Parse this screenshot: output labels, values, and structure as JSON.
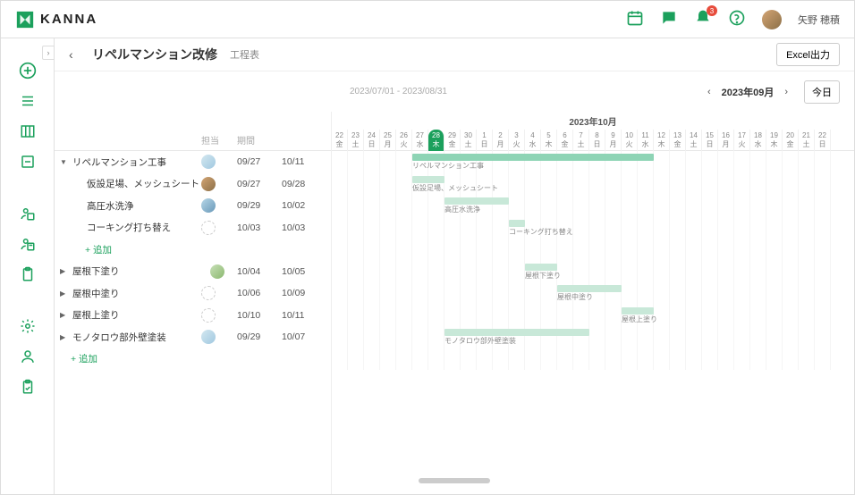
{
  "header": {
    "brand": "KANNA",
    "notification_count": "3",
    "username": "矢野 穂積"
  },
  "page": {
    "title": "リペルマンション改修",
    "subtitle": "工程表",
    "excel_button": "Excel出力",
    "date_range": "2023/07/01 - 2023/08/31",
    "current_month": "2023年09月",
    "today_button": "今日"
  },
  "columns": {
    "assignee": "担当",
    "period": "期間"
  },
  "timeline": {
    "month_label": "2023年10月",
    "today_index": 6,
    "days": [
      {
        "d": "22",
        "w": "金"
      },
      {
        "d": "23",
        "w": "土"
      },
      {
        "d": "24",
        "w": "日"
      },
      {
        "d": "25",
        "w": "月"
      },
      {
        "d": "26",
        "w": "火"
      },
      {
        "d": "27",
        "w": "水"
      },
      {
        "d": "28",
        "w": "木"
      },
      {
        "d": "29",
        "w": "金"
      },
      {
        "d": "30",
        "w": "土"
      },
      {
        "d": "1",
        "w": "日"
      },
      {
        "d": "2",
        "w": "月"
      },
      {
        "d": "3",
        "w": "火"
      },
      {
        "d": "4",
        "w": "水"
      },
      {
        "d": "5",
        "w": "木"
      },
      {
        "d": "6",
        "w": "金"
      },
      {
        "d": "7",
        "w": "土"
      },
      {
        "d": "8",
        "w": "日"
      },
      {
        "d": "9",
        "w": "月"
      },
      {
        "d": "10",
        "w": "火"
      },
      {
        "d": "11",
        "w": "水"
      },
      {
        "d": "12",
        "w": "木"
      },
      {
        "d": "13",
        "w": "金"
      },
      {
        "d": "14",
        "w": "土"
      },
      {
        "d": "15",
        "w": "日"
      },
      {
        "d": "16",
        "w": "月"
      },
      {
        "d": "17",
        "w": "火"
      },
      {
        "d": "18",
        "w": "水"
      },
      {
        "d": "19",
        "w": "木"
      },
      {
        "d": "20",
        "w": "金"
      },
      {
        "d": "21",
        "w": "土"
      },
      {
        "d": "22",
        "w": "日"
      }
    ]
  },
  "tasks": [
    {
      "name": "リペルマンション工事",
      "indent": 0,
      "expand": "down",
      "avatar": "a1",
      "start": "09/27",
      "end": "10/11",
      "bar_start": 5,
      "bar_len": 15,
      "bar_label": "リペルマンション工事",
      "bar_class": ""
    },
    {
      "name": "仮設足場、メッシュシート",
      "indent": 1,
      "avatar": "a2",
      "start": "09/27",
      "end": "09/28",
      "bar_start": 5,
      "bar_len": 2,
      "bar_label": "仮設足場、メッシュシート",
      "bar_class": "light"
    },
    {
      "name": "高圧水洗浄",
      "indent": 1,
      "avatar": "a3",
      "start": "09/29",
      "end": "10/02",
      "bar_start": 7,
      "bar_len": 4,
      "bar_label": "高圧水洗浄",
      "bar_class": "light"
    },
    {
      "name": "コーキング打ち替え",
      "indent": 1,
      "avatar": "a4",
      "start": "10/03",
      "end": "10/03",
      "bar_start": 11,
      "bar_len": 1,
      "bar_label": "コーキング打ち替え",
      "bar_class": "light"
    },
    {
      "name": "+ 追加",
      "indent": 1,
      "add": true
    },
    {
      "name": "屋根下塗り",
      "indent": 0,
      "expand": "right",
      "avatar": "dbl",
      "start": "10/04",
      "end": "10/05",
      "bar_start": 12,
      "bar_len": 2,
      "bar_label": "屋根下塗り",
      "bar_class": "light"
    },
    {
      "name": "屋根中塗り",
      "indent": 0,
      "expand": "right",
      "avatar": "a4",
      "start": "10/06",
      "end": "10/09",
      "bar_start": 14,
      "bar_len": 4,
      "bar_label": "屋根中塗り",
      "bar_class": "light"
    },
    {
      "name": "屋根上塗り",
      "indent": 0,
      "expand": "right",
      "avatar": "a4",
      "start": "10/10",
      "end": "10/11",
      "bar_start": 18,
      "bar_len": 2,
      "bar_label": "屋根上塗り",
      "bar_class": "light"
    },
    {
      "name": "モノタロウ部外壁塗装",
      "indent": 0,
      "expand": "right",
      "avatar": "a1",
      "start": "09/29",
      "end": "10/07",
      "bar_start": 7,
      "bar_len": 9,
      "bar_label": "モノタロウ部外壁塗装",
      "bar_class": "light"
    },
    {
      "name": "+ 追加",
      "indent": 0,
      "add": true
    }
  ]
}
